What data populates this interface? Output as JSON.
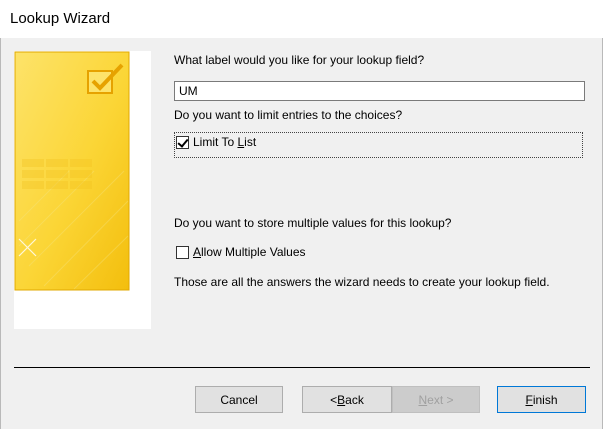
{
  "window": {
    "title": "Lookup Wizard"
  },
  "questions": {
    "label_prompt": "What label would you like for your lookup field?",
    "label_value": "UM",
    "limit_prompt": "Do you want to limit entries to the choices?",
    "limit_checkbox": {
      "prefix": "Limit To ",
      "mnemonic": "L",
      "suffix": "ist",
      "checked": true
    },
    "multi_prompt": "Do you want to store multiple values for this lookup?",
    "multi_checkbox": {
      "mnemonic": "A",
      "suffix": "llow Multiple Values",
      "checked": false
    },
    "final_note": "Those are all the answers the wizard needs to create your lookup field."
  },
  "buttons": {
    "cancel": "Cancel",
    "back": {
      "prefix": "< ",
      "mnemonic": "B",
      "suffix": "ack"
    },
    "next": {
      "mnemonic": "N",
      "suffix": "ext >"
    },
    "finish": {
      "mnemonic": "F",
      "suffix": "inish"
    }
  },
  "colors": {
    "accent_yellow": "#fbd535",
    "accent_dark": "#f2b705",
    "default_button_border": "#0078d7"
  },
  "icons": {
    "wizard_image": "checkbox-check-icon"
  }
}
